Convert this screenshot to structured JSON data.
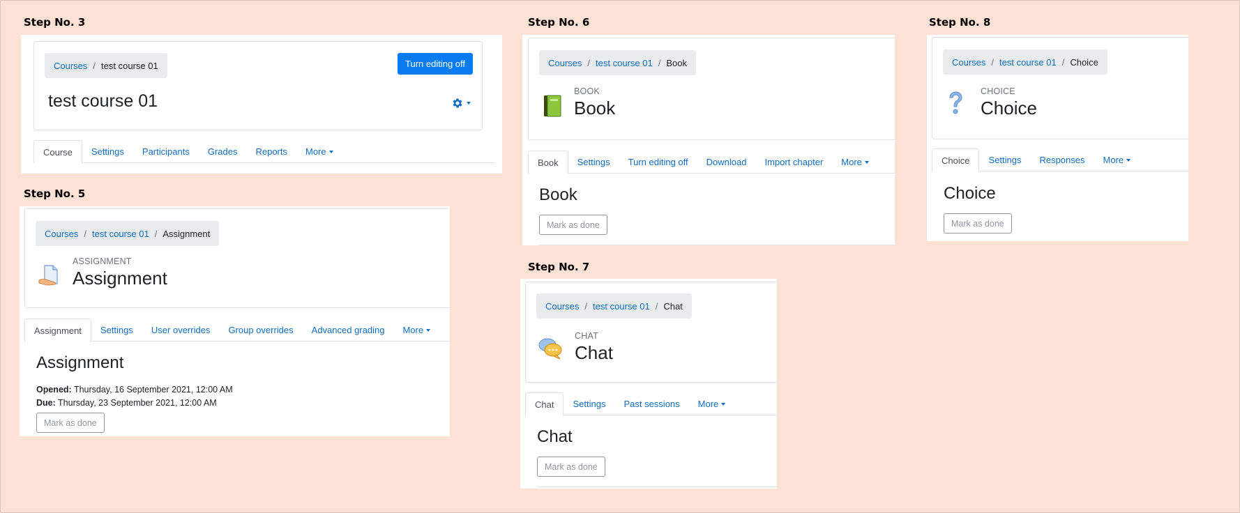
{
  "steps": {
    "s3": {
      "title": "Step No. 3",
      "breadcrumb": [
        "Courses",
        "test course 01"
      ],
      "course_title": "test course 01",
      "edit_button": "Turn editing off",
      "tabs": [
        "Course",
        "Settings",
        "Participants",
        "Grades",
        "Reports",
        "More"
      ]
    },
    "s5": {
      "title": "Step No. 5",
      "breadcrumb": [
        "Courses",
        "test course 01",
        "Assignment"
      ],
      "type_label": "ASSIGNMENT",
      "mod_title": "Assignment",
      "tabs": [
        "Assignment",
        "Settings",
        "User overrides",
        "Group overrides",
        "Advanced grading",
        "More"
      ],
      "page_heading": "Assignment",
      "opened_label": "Opened:",
      "opened_value": "Thursday, 16 September 2021, 12:00 AM",
      "due_label": "Due:",
      "due_value": "Thursday, 23 September 2021, 12:00 AM",
      "mark_done": "Mark as done"
    },
    "s6": {
      "title": "Step No. 6",
      "breadcrumb": [
        "Courses",
        "test course 01",
        "Book"
      ],
      "type_label": "BOOK",
      "mod_title": "Book",
      "tabs": [
        "Book",
        "Settings",
        "Turn editing off",
        "Download",
        "Import chapter",
        "More"
      ],
      "page_heading": "Book",
      "mark_done": "Mark as done"
    },
    "s7": {
      "title": "Step No. 7",
      "breadcrumb": [
        "Courses",
        "test course 01",
        "Chat"
      ],
      "type_label": "CHAT",
      "mod_title": "Chat",
      "tabs": [
        "Chat",
        "Settings",
        "Past sessions",
        "More"
      ],
      "page_heading": "Chat",
      "mark_done": "Mark as done"
    },
    "s8": {
      "title": "Step No. 8",
      "breadcrumb": [
        "Courses",
        "test course 01",
        "Choice"
      ],
      "type_label": "CHOICE",
      "mod_title": "Choice",
      "tabs": [
        "Choice",
        "Settings",
        "Responses",
        "More"
      ],
      "page_heading": "Choice",
      "mark_done": "Mark as done"
    }
  },
  "colors": {
    "background": "#fce1d4",
    "link": "#0f6cbf",
    "primary_button": "#0a7cf2",
    "breadcrumb_bg": "#e9ecef"
  },
  "icons": [
    "gear-icon",
    "book-icon",
    "assignment-icon",
    "chat-icon",
    "choice-question-icon"
  ]
}
